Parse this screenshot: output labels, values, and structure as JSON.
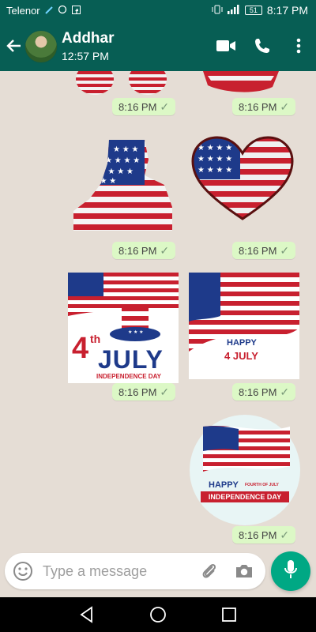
{
  "status_bar": {
    "carrier": "Telenor",
    "battery": "51",
    "time": "8:17 PM"
  },
  "header": {
    "contact_name": "Addhar",
    "last_seen": "12:57 PM"
  },
  "messages": [
    {
      "time": "8:16 PM"
    },
    {
      "time": "8:16 PM"
    },
    {
      "time": "8:16 PM"
    },
    {
      "time": "8:16 PM"
    },
    {
      "time": "8:16 PM"
    },
    {
      "time": "8:16 PM"
    },
    {
      "time": "8:16 PM"
    }
  ],
  "sticker_texts": {
    "july_4": "4",
    "july_th": "th",
    "july_word": "JULY",
    "independence_day": "INDEPENDENCE DAY",
    "happy": "HAPPY",
    "july_small": "4 JULY",
    "happy_badge": "HAPPY",
    "fourth_of_july": "FOURTH OF JULY",
    "independence_day_badge": "INDEPENDENCE DAY"
  },
  "composer": {
    "placeholder": "Type a message"
  },
  "colors": {
    "brand": "#075e54",
    "bubble": "#dcf8c6",
    "accent": "#00a884",
    "flag_red": "#c8202f",
    "flag_blue": "#1e3a8a"
  }
}
